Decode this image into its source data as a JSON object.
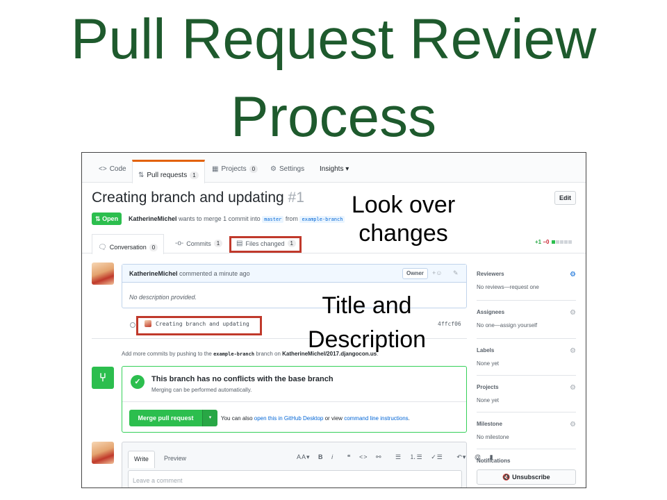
{
  "slide": {
    "title_line1": "Pull Request Review",
    "title_line2": "Process"
  },
  "repo_nav": {
    "tabs": [
      {
        "icon": "code-icon",
        "glyph": "<>",
        "label": "Code"
      },
      {
        "icon": "pull-request-icon",
        "glyph": "⇅",
        "label": "Pull requests",
        "count": "1",
        "selected": true
      },
      {
        "icon": "project-icon",
        "glyph": "▦",
        "label": "Projects",
        "count": "0"
      },
      {
        "icon": "gear-icon",
        "glyph": "⚙",
        "label": "Settings"
      },
      {
        "icon": "",
        "glyph": "",
        "label": "Insights ▾"
      }
    ]
  },
  "pr": {
    "title": "Creating branch and updating",
    "number": "#1",
    "edit_label": "Edit",
    "state": "Open",
    "state_glyph": "⇅",
    "author": "KatherineMichel",
    "meta_middle": "wants to merge 1 commit into",
    "base_branch": "master",
    "meta_from": "from",
    "head_branch": "example-branch"
  },
  "pr_tabs": {
    "conversation": {
      "label": "Conversation",
      "count": "0",
      "glyph": "🗨"
    },
    "commits": {
      "label": "Commits",
      "count": "1",
      "glyph": "-o-"
    },
    "files": {
      "label": "Files changed",
      "count": "1",
      "glyph": "▤"
    }
  },
  "diffstat": {
    "additions": "+1",
    "deletions": "−0"
  },
  "annotations": {
    "look_over_1": "Look over",
    "look_over_2": "changes",
    "title_desc_1": "Title and",
    "title_desc_2": "Description"
  },
  "comment": {
    "author": "KatherineMichel",
    "time": "commented a minute ago",
    "role": "Owner",
    "reaction_glyph": "+☺",
    "edit_glyph": "✎",
    "body": "No description provided."
  },
  "commit": {
    "message": "Creating branch and updating",
    "sha": "4ffcf06"
  },
  "push_hint": {
    "prefix": "Add more commits by pushing to the",
    "branch": "example-branch",
    "middle": "branch on",
    "repo": "KatherineMichel/2017.djangocon.us",
    "suffix": "."
  },
  "merge": {
    "icon_glyph": "⑂",
    "check_glyph": "✓",
    "heading": "This branch has no conflicts with the base branch",
    "sub": "Merging can be performed automatically.",
    "button": "Merge pull request",
    "caret": "▾",
    "alt_prefix": "You can also",
    "alt_link1": "open this in GitHub Desktop",
    "alt_middle": "or view",
    "alt_link2": "command line instructions",
    "alt_suffix": "."
  },
  "compose": {
    "write_tab": "Write",
    "preview_tab": "Preview",
    "toolbar": [
      "AA▾",
      "B",
      "i",
      "❝",
      "<>",
      "⚯",
      "☰",
      "⒈☰",
      "✓☰",
      "↶▾",
      "@",
      "▮"
    ],
    "placeholder": "Leave a comment"
  },
  "sidebar": {
    "reviewers": {
      "label": "Reviewers",
      "value": "No reviews—request one"
    },
    "assignees": {
      "label": "Assignees",
      "value": "No one—assign yourself"
    },
    "labels": {
      "label": "Labels",
      "value": "None yet"
    },
    "projects": {
      "label": "Projects",
      "value": "None yet"
    },
    "milestone": {
      "label": "Milestone",
      "value": "No milestone"
    },
    "notifications": {
      "label": "Notifications"
    },
    "gear_glyph": "⚙",
    "unsubscribe": "🔇 Unsubscribe"
  },
  "colors": {
    "title_green": "#1e5a2d",
    "highlight_red": "#c0392b",
    "github_green": "#2cbe4e",
    "link_blue": "#0366d6",
    "tab_orange": "#e36209"
  }
}
